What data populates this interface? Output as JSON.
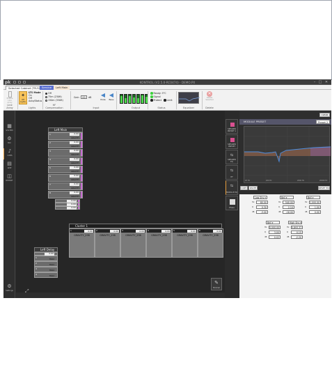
{
  "app": {
    "logo": "pk",
    "title": "KONTROL (V2.5.0-RC0474) - DEMO.PX",
    "win_min": "–",
    "win_max": "□",
    "win_close": "✕"
  },
  "tabs": [
    {
      "label": "Selected Cabinet (TR-S22)"
    },
    {
      "label": "Service"
    },
    {
      "label": "Left Main"
    }
  ],
  "ribbon": {
    "line_array_label": "Line Array",
    "enable_label": "Enable Line Array",
    "lights_label": "Lights",
    "off_lights": "Off Lights",
    "led_mode_title": "LTS Mode",
    "led_mode_on": "On",
    "led_mode_off": "Off",
    "led_mode_auto": "Auto/Status",
    "hf_label": "HF Compensation",
    "hf_off": "Off",
    "hf_opt1": "75m (230ft)",
    "hf_opt2": "150m (330ft)",
    "input_label": "Input",
    "gain_label": "Gain",
    "gain_value": "00",
    "gain_unit": "dB",
    "mute_label": "Mute",
    "bass_label": "Bass",
    "output_label": "Output",
    "output_levels": [
      0.8,
      0.6,
      0.85,
      0.7,
      0.6,
      0.9,
      0.75
    ],
    "status_label": "Status",
    "status_temp": "Ready: 5°C",
    "status_signal": "Signal",
    "status_protect": "Protect",
    "status_limit": "Limit",
    "equalizer_label": "Equalizer",
    "delete_label": "Delete",
    "delete_btn": "Delete Selected"
  },
  "sidebar": [
    {
      "icon": "▦",
      "label": "SYSTEM"
    },
    {
      "icon": "⚙",
      "label": "MIX"
    },
    {
      "icon": "♪",
      "label": "CABS"
    },
    {
      "icon": "▤",
      "label": "AMP"
    },
    {
      "icon": "◫",
      "label": "REPORT"
    }
  ],
  "sidebar_bottom": {
    "icon": "⚙",
    "label": "Settings"
  },
  "left_main": {
    "title": "Left Main",
    "channels": [
      {
        "num": "1",
        "val": "0.00",
        "name": "GRAVITY"
      },
      {
        "num": "2",
        "val": "0.00",
        "name": "GRAVITY"
      },
      {
        "num": "3",
        "val": "0.00",
        "name": "GRAVITY"
      },
      {
        "num": "4",
        "val": "0.00",
        "name": "GRAVITY"
      },
      {
        "num": "5",
        "val": "0.00",
        "name": "GRAVITY"
      },
      {
        "num": "6",
        "val": "0.00",
        "name": "GRAVITY"
      },
      {
        "num": "7",
        "val": "0.00",
        "name": "GRAVITY"
      },
      {
        "num": "8",
        "val": "0.00",
        "name": "GRAVITY"
      }
    ],
    "sub_values": [
      "0.00",
      "0.00",
      "0.00"
    ]
  },
  "cluster": {
    "title": "Cluster 1",
    "cells": [
      {
        "num": "1",
        "val": "0.00",
        "name": "GRAVITY_298"
      },
      {
        "num": "2",
        "val": "0.00",
        "name": "GRAVITY_298"
      },
      {
        "num": "3",
        "val": "0.00",
        "name": "GRAVITY_298"
      },
      {
        "num": "4",
        "val": "0.00",
        "name": "GRAVITY_298"
      },
      {
        "num": "5",
        "val": "0.00",
        "name": "GRAVITY_298"
      },
      {
        "num": "6",
        "val": "0.00",
        "name": "GRAVITY_298"
      }
    ]
  },
  "left_delay": {
    "title": "Left Delay",
    "value": "0.00",
    "rows": [
      "TR22",
      "TR22",
      "TR22",
      "TR22"
    ]
  },
  "right_tools": [
    {
      "label": "SPEAKER PRESET 1",
      "colored": true
    },
    {
      "label": "SPEAKER PRESET",
      "colored": true
    },
    {
      "label": "SPEAKER EQ",
      "colored": false
    },
    {
      "label": "HF",
      "colored": false
    },
    {
      "label": "MODULE EQ",
      "colored": false
    },
    {
      "label": "Phase",
      "colored": false
    }
  ],
  "remote_label": "Minimal",
  "eq": {
    "clear_label": "CLEAR",
    "header": "MODULE PRESET",
    "preset_value": "Preset 2",
    "freq_labels": [
      "20 Hz",
      "200 Hz",
      "2000 Hz",
      "20000 Hz"
    ],
    "copy_label": "COPY",
    "paste_label": "PASTE",
    "reset_label": "RESET EQ",
    "filters_row1": [
      {
        "type": "Low Shv",
        "freq": "80.00",
        "q": "0.30",
        "gain": "-3.00"
      },
      {
        "type": "Bell",
        "freq": "540.00",
        "q": "2.10",
        "gain": "-16.00"
      },
      {
        "type": "Bell",
        "freq": "1,000.00",
        "q": "1.00",
        "gain": "0.00"
      }
    ],
    "filters_row2": [
      {
        "type": "Bell",
        "freq": "5,000.00",
        "q": "3.00",
        "gain": "0.02"
      },
      {
        "type": "High Shv",
        "freq": "5,893.37",
        "q": "0.15",
        "gain": "-2.20"
      }
    ],
    "field_labels": [
      "Hz",
      "Q",
      "dB"
    ]
  }
}
